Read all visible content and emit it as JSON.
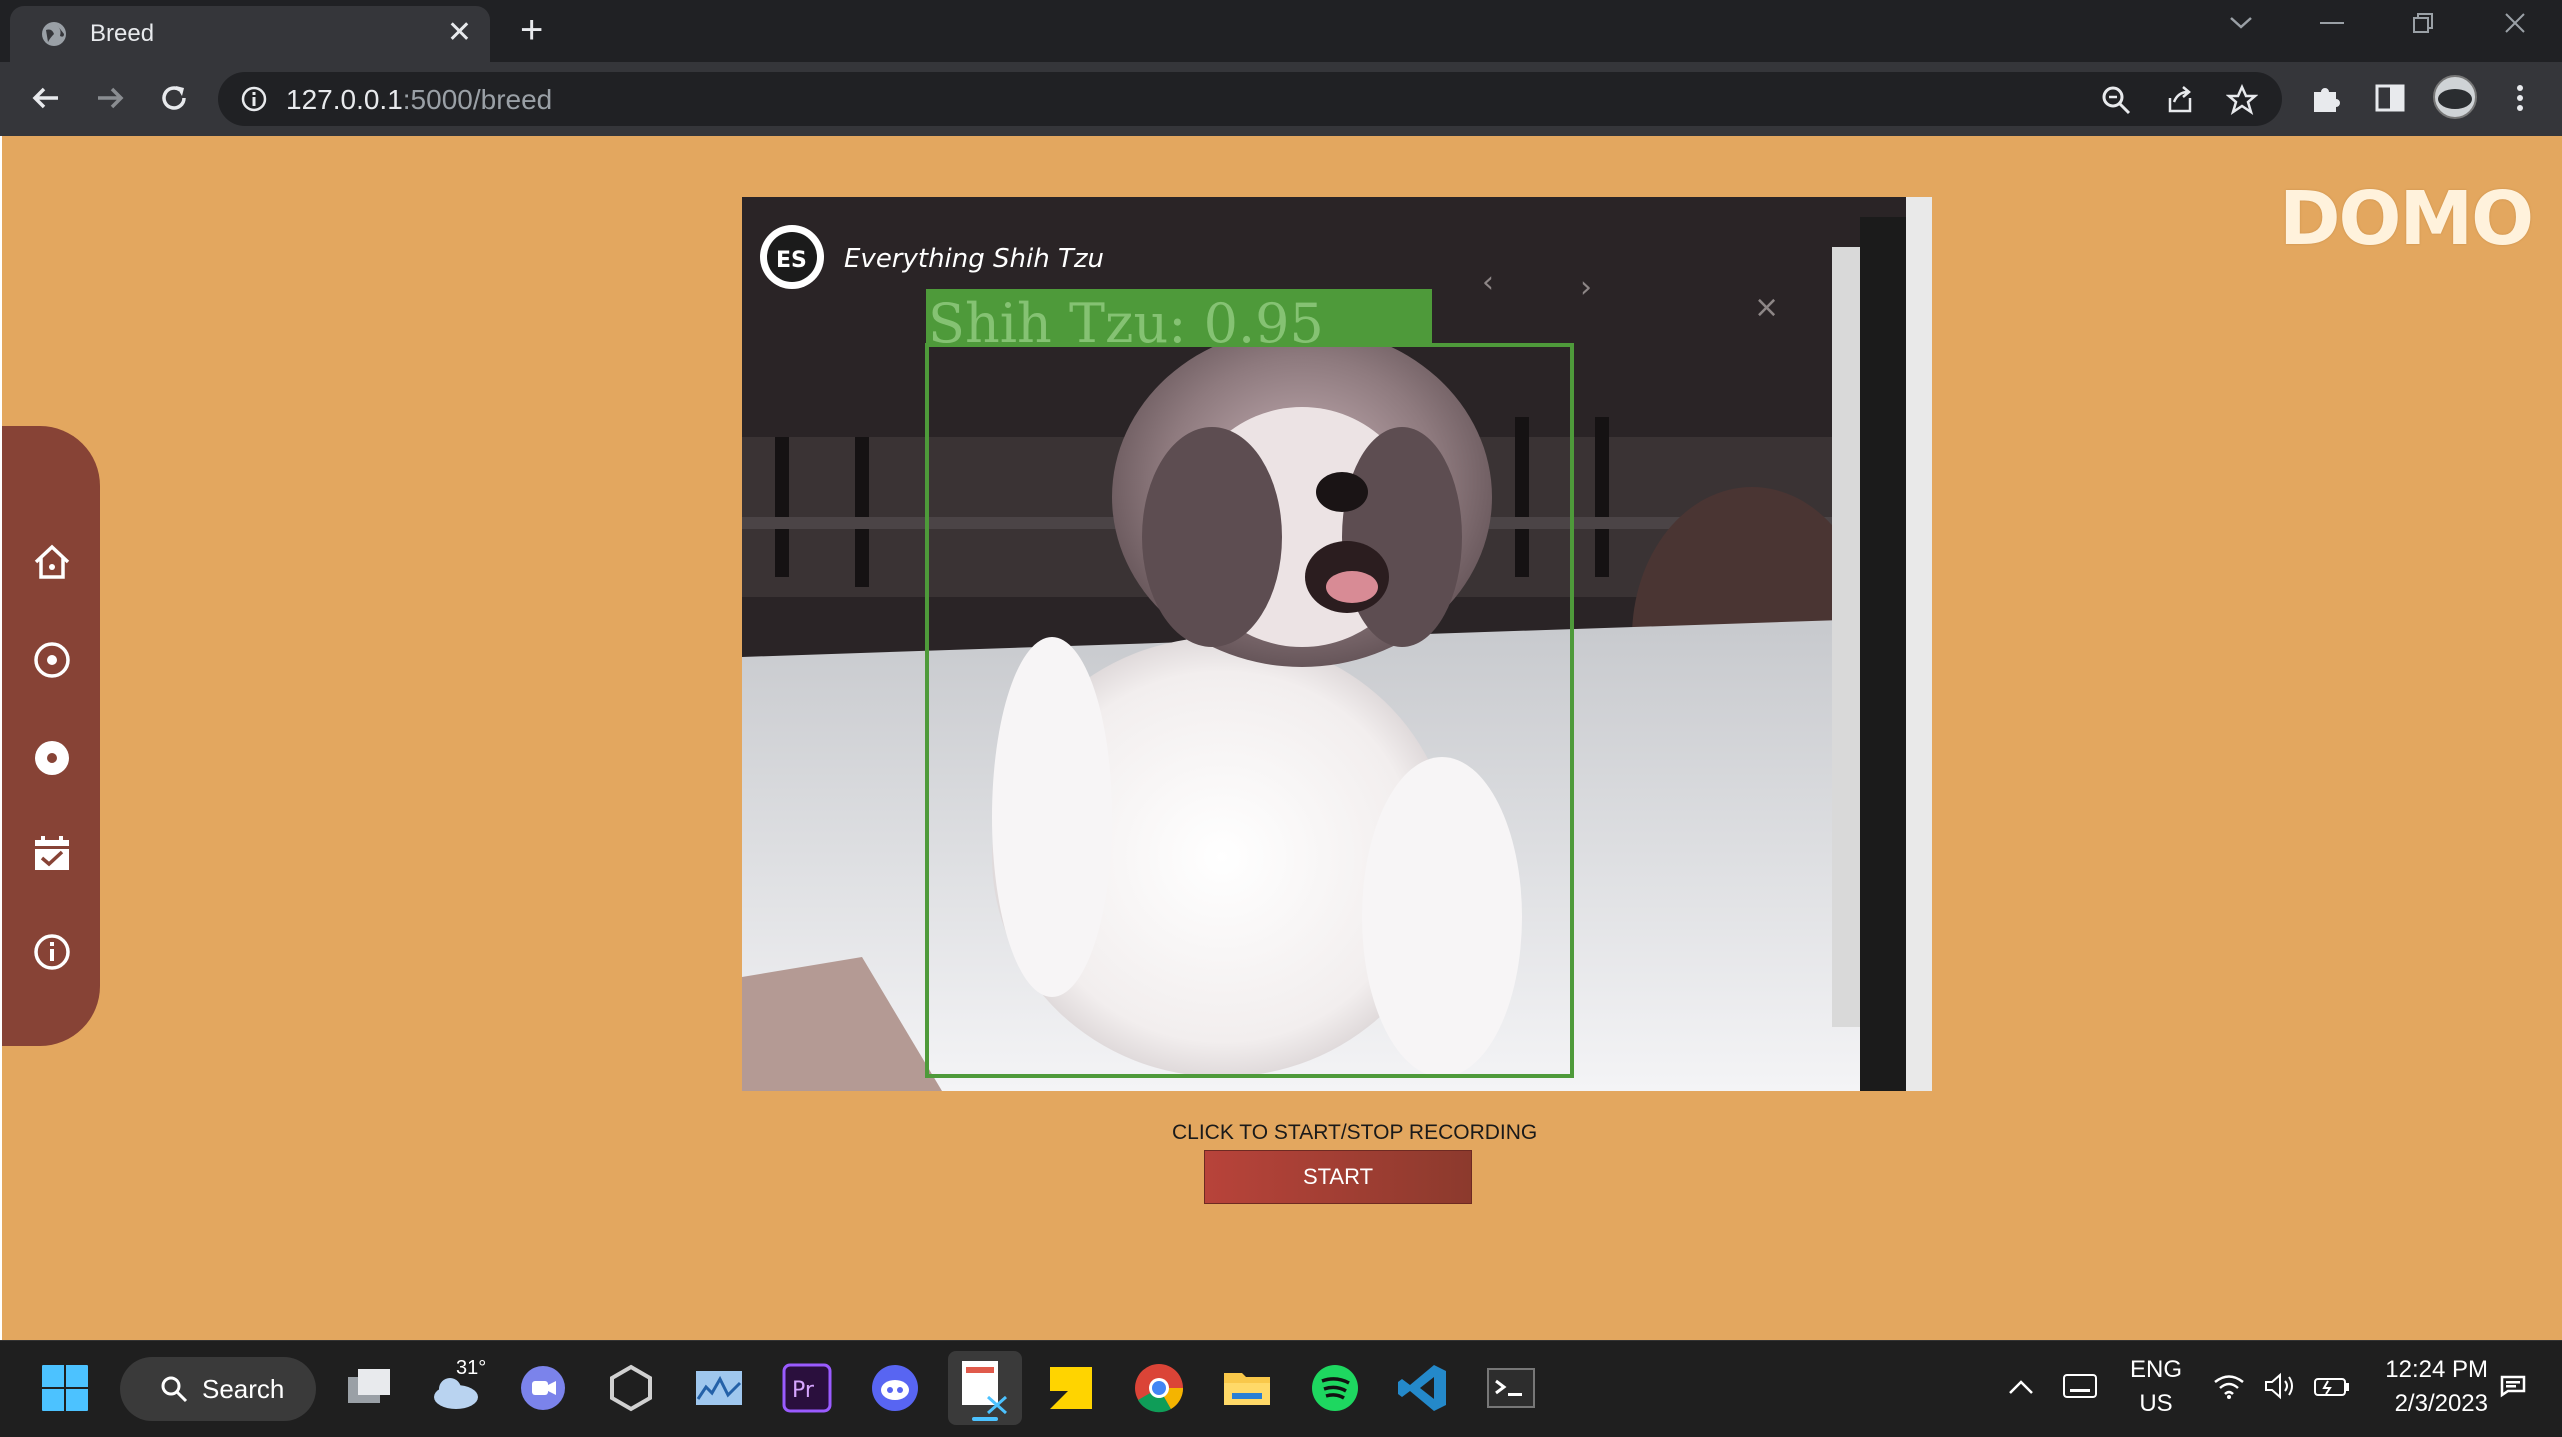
{
  "browser": {
    "tab_title": "Breed",
    "tab_close": "✕",
    "new_tab": "+",
    "url_host": "127.0.0.1",
    "url_path": ":5000/breed"
  },
  "page": {
    "logo": "DOMO",
    "sidebar": [
      "home-icon",
      "target-icon",
      "record-icon",
      "calendar-icon",
      "info-icon"
    ],
    "video": {
      "channel": "Everything Shih Tzu",
      "detection_label": "Shih Tzu: 0.95",
      "box_color": "#4e9a3a"
    },
    "hint": "CLICK TO START/STOP RECORDING",
    "start_label": "START"
  },
  "taskbar": {
    "search_label": "Search",
    "weather_temp": "31°",
    "lang_top": "ENG",
    "lang_bottom": "US",
    "time": "12:24 PM",
    "date": "2/3/2023"
  },
  "colors": {
    "page_bg": "#e3a75f",
    "sidebar_bg": "#874336",
    "button_bg": "#b8433a"
  }
}
